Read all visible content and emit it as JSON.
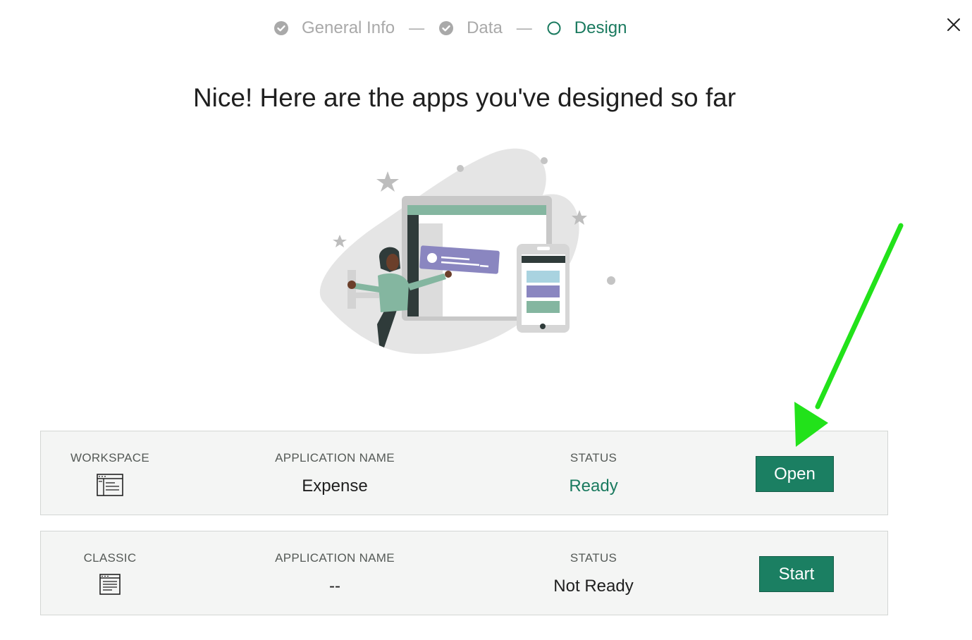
{
  "stepper": {
    "steps": [
      {
        "label": "General Info",
        "state": "done"
      },
      {
        "label": "Data",
        "state": "done"
      },
      {
        "label": "Design",
        "state": "active"
      }
    ],
    "separator": "—"
  },
  "headline": "Nice! Here are the apps you've designed so far",
  "apps": [
    {
      "type_label": "WORKSPACE",
      "type_icon": "workspace-layout-icon",
      "name_header": "APPLICATION NAME",
      "name_value": "Expense",
      "status_header": "STATUS",
      "status_value": "Ready",
      "action_label": "Open"
    },
    {
      "type_label": "CLASSIC",
      "type_icon": "classic-document-icon",
      "name_header": "APPLICATION NAME",
      "name_value": "--",
      "status_header": "STATUS",
      "status_value": "Not Ready",
      "action_label": "Start"
    }
  ],
  "colors": {
    "accent": "#1b7f62",
    "active_step": "#1a7a5f",
    "muted": "#a9a9a9",
    "annotation_arrow": "#22e21a"
  },
  "icons": {
    "close": "close-icon",
    "step_done": "check-circle-icon",
    "step_active": "circle-outline-icon"
  }
}
